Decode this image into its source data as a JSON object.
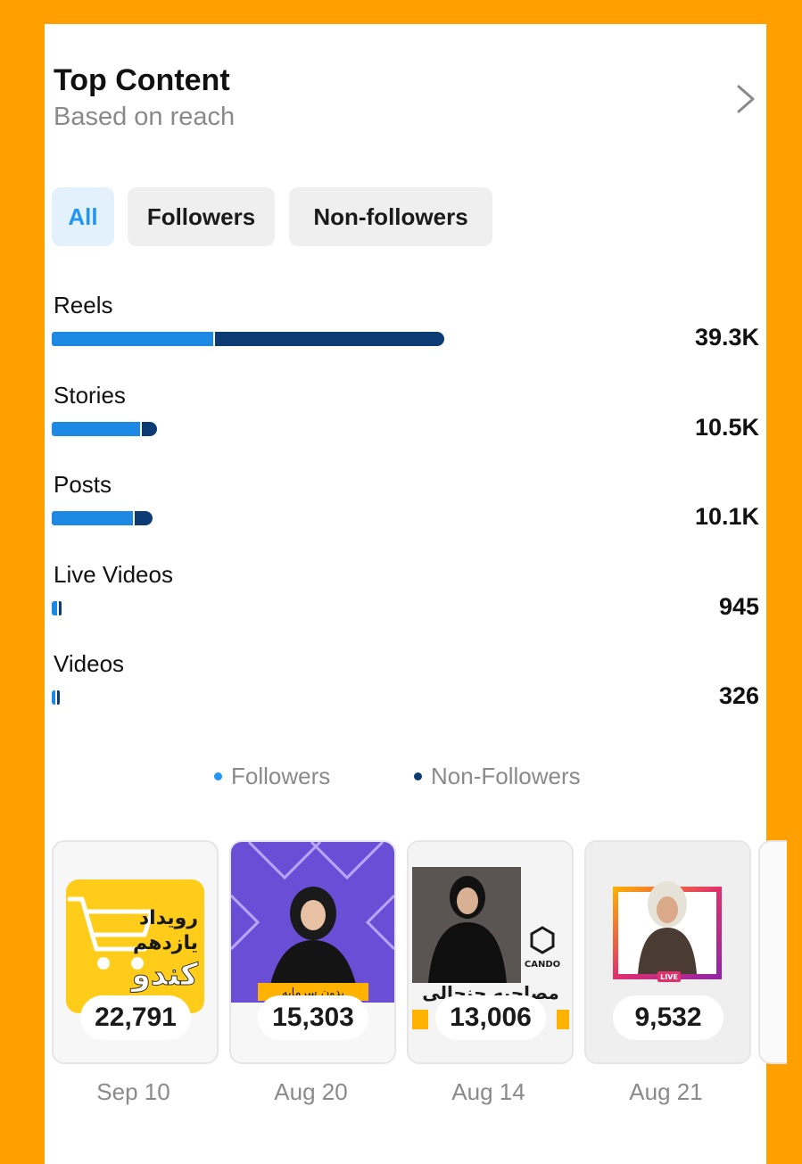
{
  "header": {
    "title": "Top Content",
    "subtitle": "Based on reach"
  },
  "tabs": [
    {
      "label": "All",
      "active": true
    },
    {
      "label": "Followers",
      "active": false
    },
    {
      "label": "Non-followers",
      "active": false
    }
  ],
  "chart_data": {
    "type": "bar",
    "orientation": "horizontal",
    "stacked": true,
    "categories": [
      "Reels",
      "Stories",
      "Posts",
      "Live Videos",
      "Videos"
    ],
    "value_labels": [
      "39.3K",
      "10.5K",
      "10.1K",
      "945",
      "326"
    ],
    "totals": [
      39300,
      10500,
      10100,
      945,
      326
    ],
    "series": [
      {
        "name": "Followers",
        "values": [
          16200,
          8800,
          8100,
          550,
          200
        ]
      },
      {
        "name": "Non-Followers",
        "values": [
          23100,
          1700,
          2000,
          395,
          126
        ]
      }
    ],
    "legend_position": "bottom",
    "colors": {
      "Followers": "#1e88e5",
      "Non-Followers": "#0d3b73"
    }
  },
  "legend": {
    "followers": "Followers",
    "non_followers": "Non-Followers"
  },
  "thumbnails": [
    {
      "count": "22,791",
      "date": "Sep 10",
      "caption": "رویداد یازدهم کندو"
    },
    {
      "count": "15,303",
      "date": "Aug 20",
      "caption": "بدون سرمایه"
    },
    {
      "count": "13,006",
      "date": "Aug 14",
      "caption": "مصاحبه حنجالی",
      "brand": "CANDO"
    },
    {
      "count": "9,532",
      "date": "Aug 21",
      "badge": "LIVE"
    }
  ],
  "colors": {
    "frame": "#FFA000",
    "accent_blue": "#2196f3",
    "followers": "#1e88e5",
    "non_followers": "#0d3b73"
  }
}
